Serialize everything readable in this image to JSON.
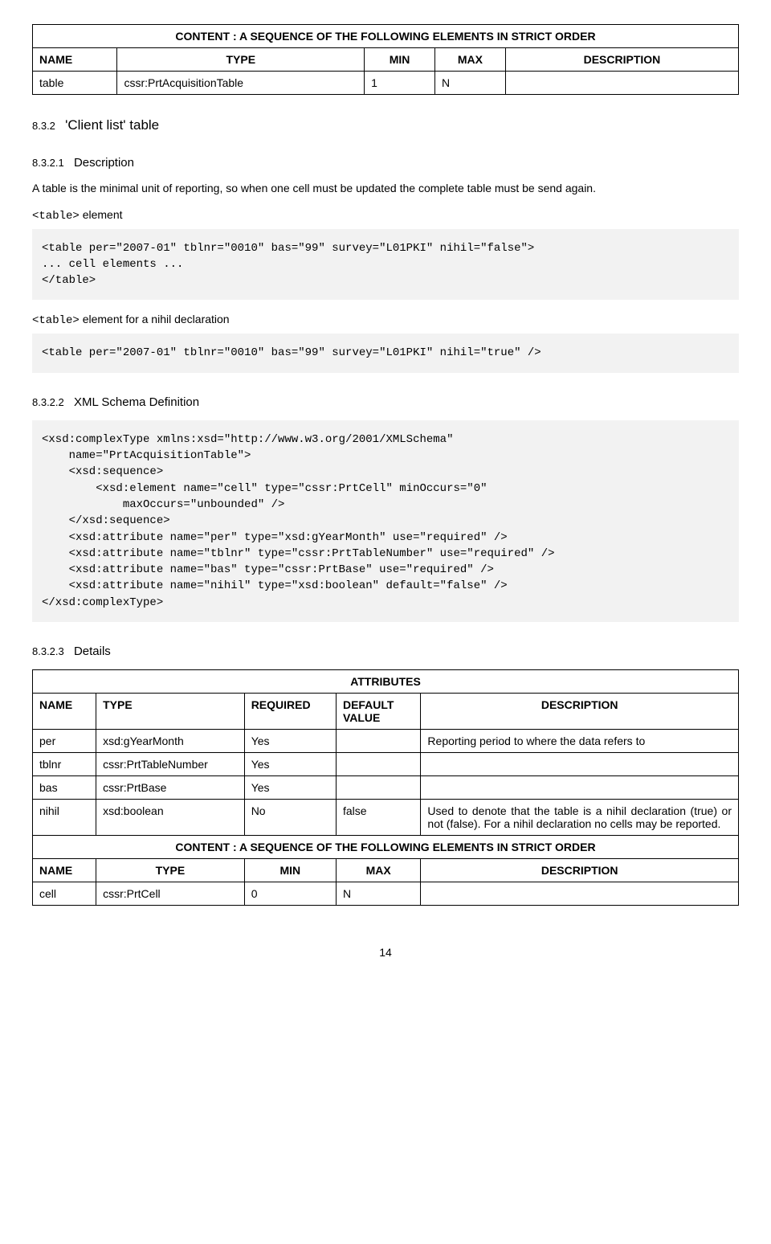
{
  "table1": {
    "title": "CONTENT : A SEQUENCE OF THE FOLLOWING ELEMENTS IN STRICT ORDER",
    "headers": {
      "name": "NAME",
      "type": "TYPE",
      "min": "MIN",
      "max": "MAX",
      "desc": "DESCRIPTION"
    },
    "row": {
      "name": "table",
      "type": "cssr:PrtAcquisitionTable",
      "min": "1",
      "max": "N",
      "desc": ""
    }
  },
  "section832": {
    "num": "8.3.2",
    "title": "'Client list' table"
  },
  "section8321": {
    "num": "8.3.2.1",
    "title": "Description"
  },
  "para1": "A table is the minimal unit of reporting, so when one cell must be updated the complete table must be send again.",
  "label_table_element_prefix": "<table>",
  "label_table_element_suffix": " element",
  "code1": "<table per=\"2007-01\" tblnr=\"0010\" bas=\"99\" survey=\"L01PKI\" nihil=\"false\">\n... cell elements ...\n</table>",
  "label_nihil_prefix": "<table>",
  "label_nihil_suffix": " element for a nihil declaration",
  "code2": "<table per=\"2007-01\" tblnr=\"0010\" bas=\"99\" survey=\"L01PKI\" nihil=\"true\" />",
  "section8322": {
    "num": "8.3.2.2",
    "title": "XML Schema Definition"
  },
  "code3": "<xsd:complexType xmlns:xsd=\"http://www.w3.org/2001/XMLSchema\"\n    name=\"PrtAcquisitionTable\">\n    <xsd:sequence>\n        <xsd:element name=\"cell\" type=\"cssr:PrtCell\" minOccurs=\"0\"\n            maxOccurs=\"unbounded\" />\n    </xsd:sequence>\n    <xsd:attribute name=\"per\" type=\"xsd:gYearMonth\" use=\"required\" />\n    <xsd:attribute name=\"tblnr\" type=\"cssr:PrtTableNumber\" use=\"required\" />\n    <xsd:attribute name=\"bas\" type=\"cssr:PrtBase\" use=\"required\" />\n    <xsd:attribute name=\"nihil\" type=\"xsd:boolean\" default=\"false\" />\n</xsd:complexType>",
  "section8323": {
    "num": "8.3.2.3",
    "title": "Details"
  },
  "table2": {
    "title_attrs": "ATTRIBUTES",
    "headers_attrs": {
      "name": "NAME",
      "type": "TYPE",
      "required": "REQUIRED",
      "default": "DEFAULT VALUE",
      "desc": "DESCRIPTION"
    },
    "rows_attrs": [
      {
        "name": "per",
        "type": "xsd:gYearMonth",
        "required": "Yes",
        "default": "",
        "desc": "Reporting period to where the data refers to"
      },
      {
        "name": "tblnr",
        "type": "cssr:PrtTableNumber",
        "required": "Yes",
        "default": "",
        "desc": ""
      },
      {
        "name": "bas",
        "type": "cssr:PrtBase",
        "required": "Yes",
        "default": "",
        "desc": ""
      },
      {
        "name": "nihil",
        "type": "xsd:boolean",
        "required": "No",
        "default": "false",
        "desc": "Used to denote that the table is a nihil declaration (true) or not (false). For a nihil declaration no cells may be reported."
      }
    ],
    "title_content": "CONTENT : A SEQUENCE OF THE FOLLOWING ELEMENTS IN STRICT ORDER",
    "headers_content": {
      "name": "NAME",
      "type": "TYPE",
      "min": "MIN",
      "max": "MAX",
      "desc": "DESCRIPTION"
    },
    "row_content": {
      "name": "cell",
      "type": "cssr:PrtCell",
      "min": "0",
      "max": "N",
      "desc": ""
    }
  },
  "page_number": "14"
}
